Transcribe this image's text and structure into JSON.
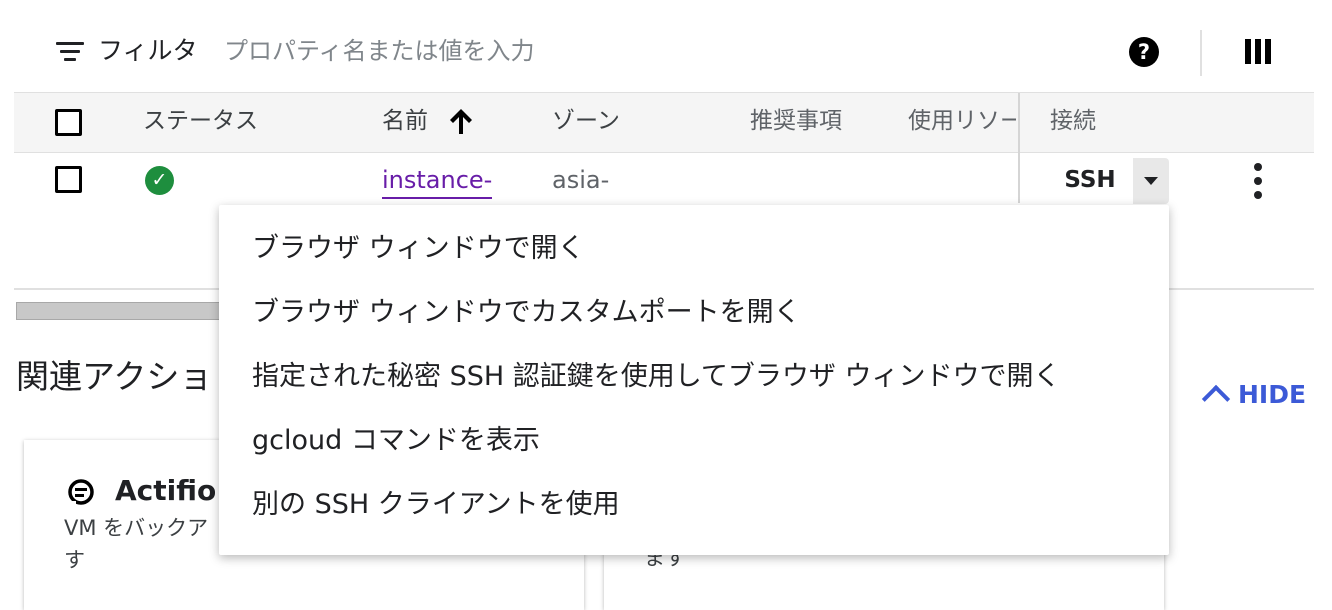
{
  "filter": {
    "label": "フィルタ",
    "placeholder": "プロパティ名または値を入力"
  },
  "toolbar": {
    "help_icon": "help-icon",
    "help_glyph": "?",
    "columns_icon": "view-columns-icon"
  },
  "table": {
    "headers": {
      "status": "ステータス",
      "name": "名前",
      "zone": "ゾーン",
      "recommendation": "推奨事項",
      "usage": "使用リソー",
      "connect": "接続"
    },
    "sort": {
      "column": "name",
      "direction": "ascending"
    },
    "rows": [
      {
        "status": "running",
        "status_color": "#1e8e3e",
        "name": "instance-",
        "zone": "asia-",
        "connect_label": "SSH"
      }
    ]
  },
  "ssh_menu": {
    "items": [
      "ブラウザ ウィンドウで開く",
      "ブラウザ ウィンドウでカスタムポートを開く",
      "指定された秘密 SSH 認証鍵を使用してブラウザ ウィンドウで開く",
      "gcloud コマンドを表示",
      "別の SSH クライアントを使用"
    ]
  },
  "related": {
    "title": "関連アクショ",
    "hide_label": "HIDE",
    "cards": [
      {
        "title": "Actifio C",
        "desc_line1": "VM をバックア",
        "desc_line2": "す"
      },
      {
        "desc_line": "ます"
      }
    ]
  },
  "colors": {
    "link": "#681da8",
    "accent": "#3c5ad7",
    "status_ok": "#1e8e3e"
  }
}
